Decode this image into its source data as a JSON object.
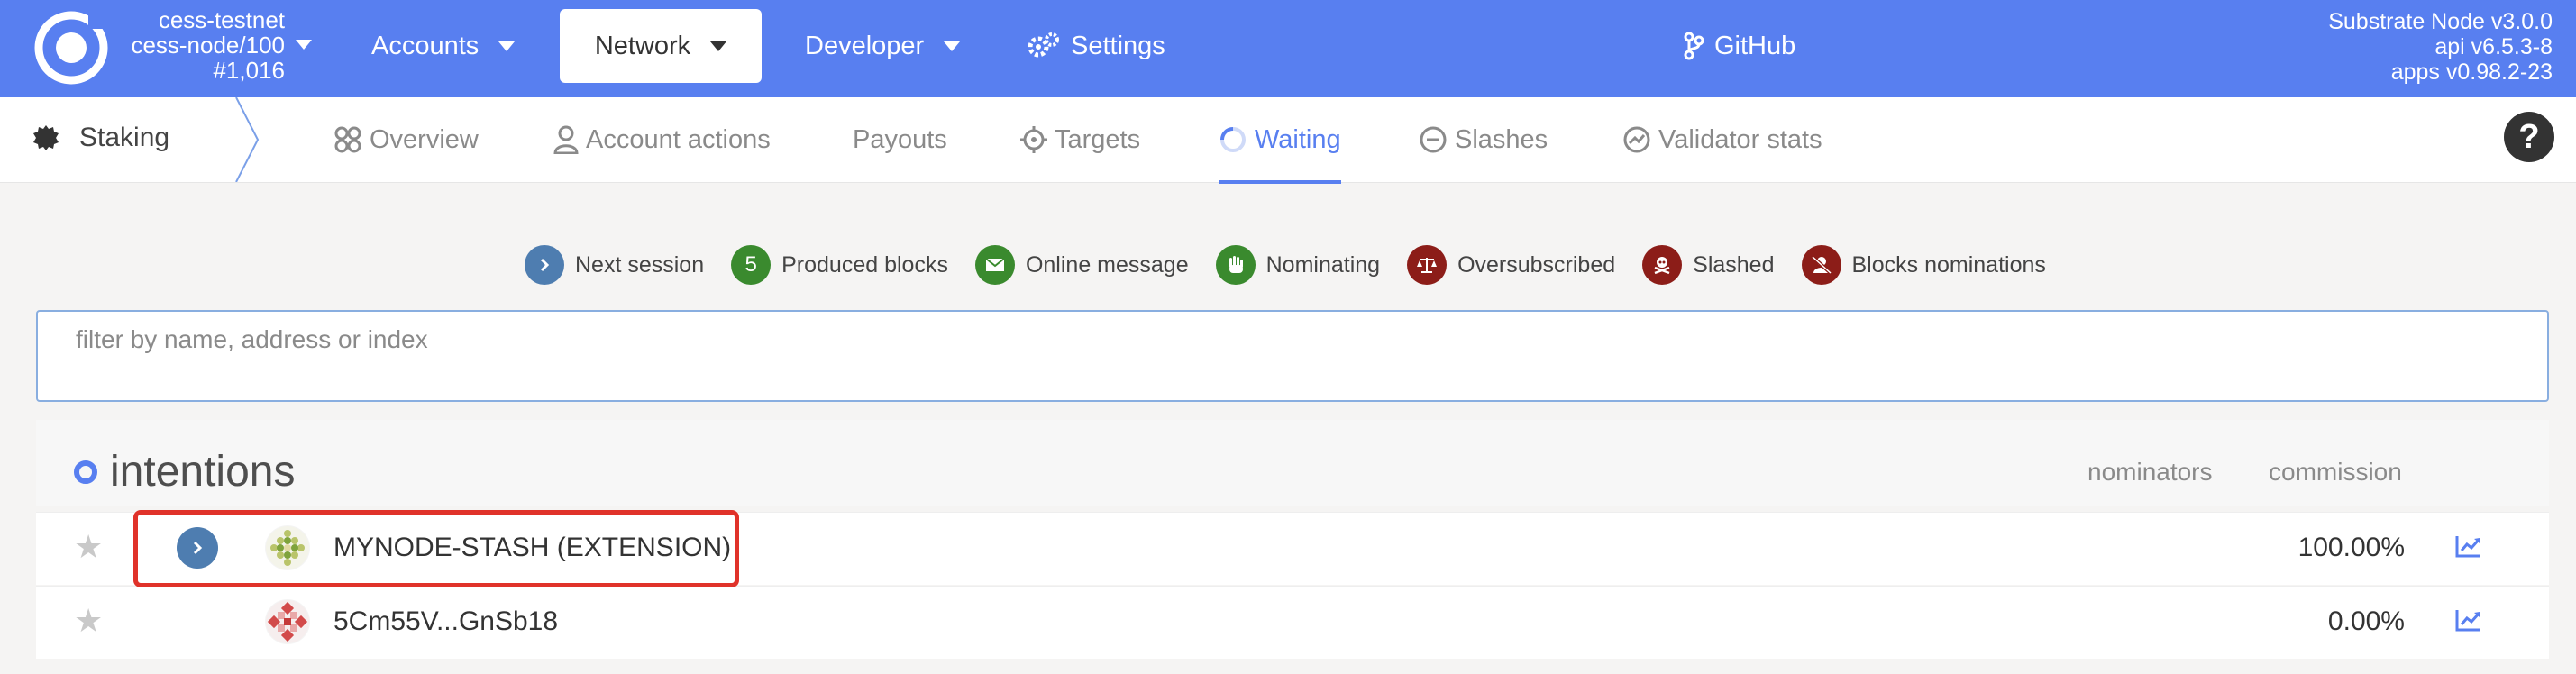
{
  "header": {
    "chain_name": "cess-testnet",
    "node_name": "cess-node/100",
    "block_number": "#1,016",
    "menu": [
      {
        "label": "Accounts"
      },
      {
        "label": "Network"
      },
      {
        "label": "Developer"
      },
      {
        "label": "Settings"
      },
      {
        "label": "GitHub"
      }
    ],
    "node_info": [
      "Substrate Node v3.0.0",
      "api v6.5.3-8",
      "apps v0.98.2-23"
    ]
  },
  "subnav": {
    "section": "Staking",
    "tabs": [
      "Overview",
      "Account actions",
      "Payouts",
      "Targets",
      "Waiting",
      "Slashes",
      "Validator stats"
    ],
    "active_tab": "Waiting",
    "help": "?"
  },
  "legend": [
    {
      "label": "Next session",
      "icon": "chevron-right-icon",
      "color": "#4e7db0"
    },
    {
      "label": "Produced blocks",
      "icon": "5",
      "color": "#3a8a2e"
    },
    {
      "label": "Online message",
      "icon": "envelope-icon",
      "color": "#3a8a2e"
    },
    {
      "label": "Nominating",
      "icon": "hand-icon",
      "color": "#3a8a2e"
    },
    {
      "label": "Oversubscribed",
      "icon": "balance-icon",
      "color": "#8c1d18"
    },
    {
      "label": "Slashed",
      "icon": "skull-icon",
      "color": "#8c1d18"
    },
    {
      "label": "Blocks nominations",
      "icon": "user-slash-icon",
      "color": "#8c1d18"
    }
  ],
  "filter": {
    "placeholder": "filter by name, address or index"
  },
  "table": {
    "title": "intentions",
    "columns": [
      "nominators",
      "commission"
    ],
    "rows": [
      {
        "name": "MYNODE-STASH (EXTENSION)",
        "commission": "100.00%"
      },
      {
        "name": "5Cm55V...GnSb18",
        "commission": "0.00%"
      }
    ]
  },
  "colors": {
    "accent": "#587ff0",
    "highlight": "#e0322a"
  }
}
